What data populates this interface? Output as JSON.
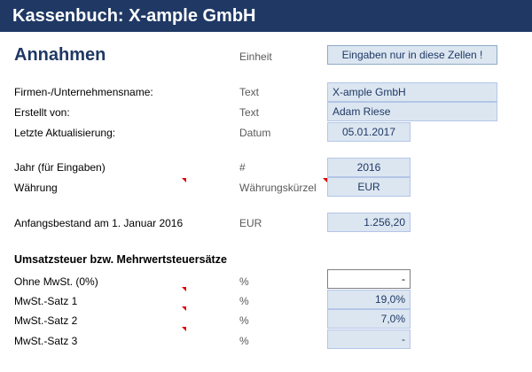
{
  "banner": {
    "title": "Kassenbuch: X-ample GmbH"
  },
  "heading": "Annahmen",
  "unit_header": "Einheit",
  "input_hint": "Eingaben nur in diese Zellen !",
  "company": {
    "label": "Firmen-/Unternehmensname:",
    "unit": "Text",
    "value": "X-ample GmbH"
  },
  "created_by": {
    "label": "Erstellt von:",
    "unit": "Text",
    "value": "Adam Riese"
  },
  "last_update": {
    "label": "Letzte Aktualisierung:",
    "unit": "Datum",
    "value": "05.01.2017"
  },
  "year": {
    "label": "Jahr (für Eingaben)",
    "unit": "#",
    "value": "2016"
  },
  "currency": {
    "label": "Währung",
    "unit": "Währungskürzel",
    "value": "EUR"
  },
  "opening_balance": {
    "label": "Anfangsbestand am 1. Januar 2016",
    "unit": "EUR",
    "value": "1.256,20"
  },
  "vat_section": {
    "title": "Umsatzsteuer bzw. Mehrwertsteuersätze",
    "rows": [
      {
        "label": "Ohne MwSt. (0%)",
        "unit": "%",
        "value": "-"
      },
      {
        "label": "MwSt.-Satz 1",
        "unit": "%",
        "value": "19,0%"
      },
      {
        "label": "MwSt.-Satz 2",
        "unit": "%",
        "value": "7,0%"
      },
      {
        "label": "MwSt.-Satz 3",
        "unit": "%",
        "value": "-"
      }
    ]
  },
  "colors": {
    "banner": "#1f3864",
    "input_fill": "#dce6f1",
    "note_marker": "#e00000"
  }
}
